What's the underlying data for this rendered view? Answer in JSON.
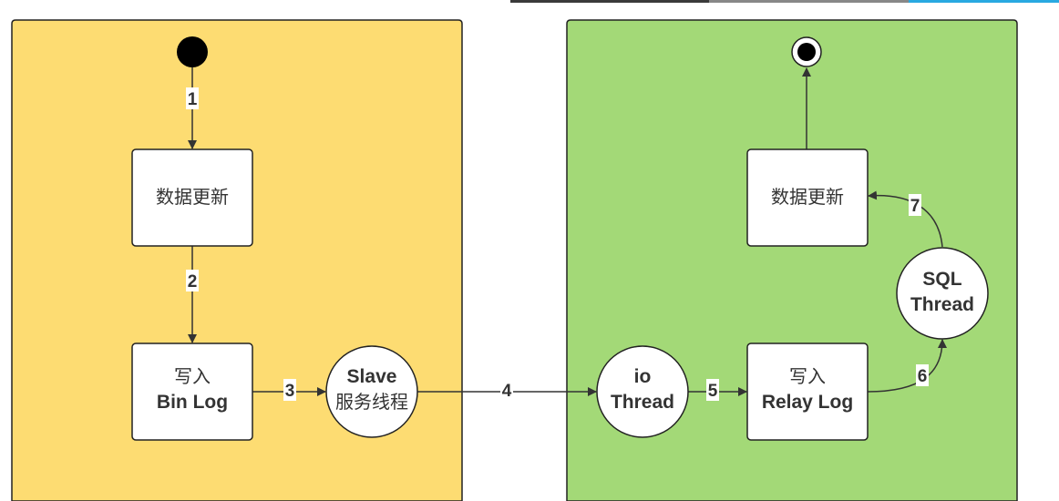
{
  "colors": {
    "master_panel": "#FDDC72",
    "slave_panel": "#A3D977",
    "progress": [
      "#3a3a3a",
      "#888888",
      "#29A9E1"
    ]
  },
  "master": {
    "update_box": "数据更新",
    "binlog_box": [
      "写入",
      "Bin Log"
    ],
    "slave_thread": [
      "Slave",
      "服务线程"
    ]
  },
  "slave": {
    "io_thread": [
      "io",
      "Thread"
    ],
    "relay_box": [
      "写入",
      "Relay Log"
    ],
    "sql_thread": [
      "SQL",
      "Thread"
    ],
    "update_box": "数据更新"
  },
  "edges": [
    "1",
    "2",
    "3",
    "4",
    "5",
    "6",
    "7"
  ]
}
